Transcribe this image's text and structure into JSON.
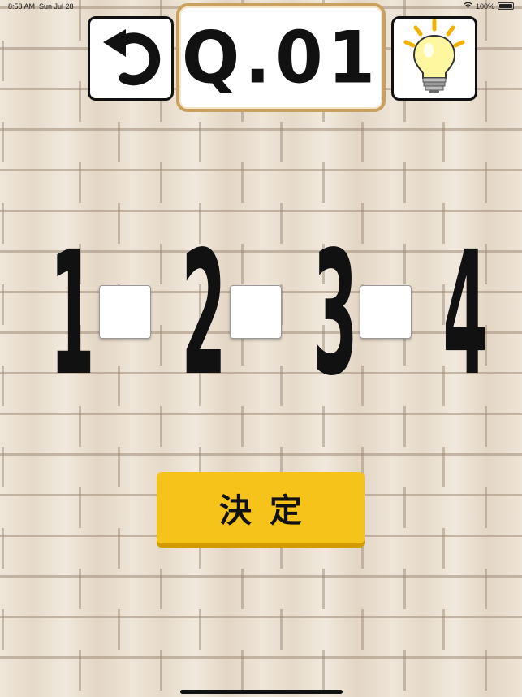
{
  "status_bar": {
    "time": "8:58 AM",
    "date": "Sun Jul 28",
    "battery_text": "100%",
    "battery_level": 1.0
  },
  "header": {
    "title": "Q.01",
    "undo_icon": "undo-arrow-icon",
    "hint_icon": "lightbulb-icon"
  },
  "puzzle": {
    "digits": [
      "1",
      "2",
      "3",
      "4"
    ],
    "slots": [
      "",
      "",
      ""
    ]
  },
  "confirm_button": {
    "label": "決定",
    "color": "#f6c31a"
  },
  "colors": {
    "title_border": "#c9a060",
    "background": "#e9ded0"
  }
}
